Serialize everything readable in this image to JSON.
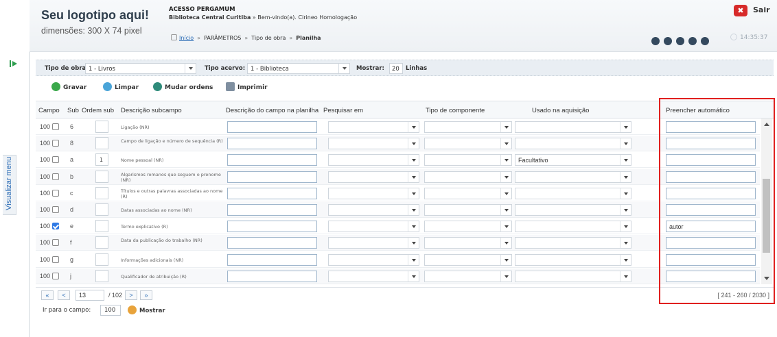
{
  "header": {
    "logo_title": "Seu logotipo aqui!",
    "logo_subtitle": "dimensões: 300 X 74 pixel",
    "app_name": "ACESSO PERGAMUM",
    "library": "Biblioteca Central Curitiba",
    "welcome": "» Bem-vindo(a). Cirineo Homologação",
    "logout_label": "Sair",
    "clock": "14:35:37",
    "breadcrumb": [
      "Início",
      "PARÂMETROS",
      "Tipo de obra",
      "Planilha"
    ]
  },
  "sidebar": {
    "menu_label": "Visualizar menu"
  },
  "filters": {
    "tipo_obra_label": "Tipo de obra:",
    "tipo_obra_value": "1 - Livros",
    "tipo_acervo_label": "Tipo acervo:",
    "tipo_acervo_value": "1 - Biblioteca",
    "mostrar_label": "Mostrar:",
    "mostrar_value": "20",
    "linhas_label": "Linhas"
  },
  "actions": {
    "gravar": "Gravar",
    "limpar": "Limpar",
    "mudar_ordens": "Mudar ordens",
    "imprimir": "Imprimir"
  },
  "columns": [
    "Campo",
    "Sub",
    "Ordem sub",
    "Descrição subcampo",
    "Descrição do campo na planilha",
    "Pesquisar em",
    "Tipo de componente",
    "Usado na aquisição",
    "Preencher automático"
  ],
  "rows": [
    {
      "campo": "100",
      "checked": false,
      "sub": "6",
      "ordem": "",
      "desc": "Ligação (NR)",
      "usado": "",
      "preencher": ""
    },
    {
      "campo": "100",
      "checked": false,
      "sub": "8",
      "ordem": "",
      "desc": "Campo de ligação e número de sequência (R)",
      "usado": "",
      "preencher": ""
    },
    {
      "campo": "100",
      "checked": false,
      "sub": "a",
      "ordem": "1",
      "desc": "Nome pessoal (NR)",
      "usado": "Facultativo",
      "preencher": ""
    },
    {
      "campo": "100",
      "checked": false,
      "sub": "b",
      "ordem": "",
      "desc": "Algarismos romanos que seguem o prenome (NR)",
      "usado": "",
      "preencher": ""
    },
    {
      "campo": "100",
      "checked": false,
      "sub": "c",
      "ordem": "",
      "desc": "Títulos e outras palavras associadas ao nome (R)",
      "usado": "",
      "preencher": ""
    },
    {
      "campo": "100",
      "checked": false,
      "sub": "d",
      "ordem": "",
      "desc": "Datas associadas ao nome (NR)",
      "usado": "",
      "preencher": ""
    },
    {
      "campo": "100",
      "checked": true,
      "sub": "e",
      "ordem": "",
      "desc": "Termo explicativo (R)",
      "usado": "",
      "preencher": "autor"
    },
    {
      "campo": "100",
      "checked": false,
      "sub": "f",
      "ordem": "",
      "desc": "Data da publicação do trabalho (NR)",
      "usado": "",
      "preencher": ""
    },
    {
      "campo": "100",
      "checked": false,
      "sub": "g",
      "ordem": "",
      "desc": "Informações adicionais (NR)",
      "usado": "",
      "preencher": ""
    },
    {
      "campo": "100",
      "checked": false,
      "sub": "j",
      "ordem": "",
      "desc": "Qualificador de atribuição (R)",
      "usado": "",
      "preencher": ""
    }
  ],
  "pager": {
    "first": "«",
    "prev": "<",
    "next": ">",
    "last": "»",
    "page": "13",
    "total": "/ 102",
    "range": "[ 241 - 260 / 2030 ]"
  },
  "goto": {
    "label": "Ir para o campo:",
    "value": "100",
    "button": "Mostrar"
  },
  "colors": {
    "accent_blue": "#2a6bb5",
    "highlight_red": "#e0201f",
    "logout_red": "#d72a2a"
  }
}
